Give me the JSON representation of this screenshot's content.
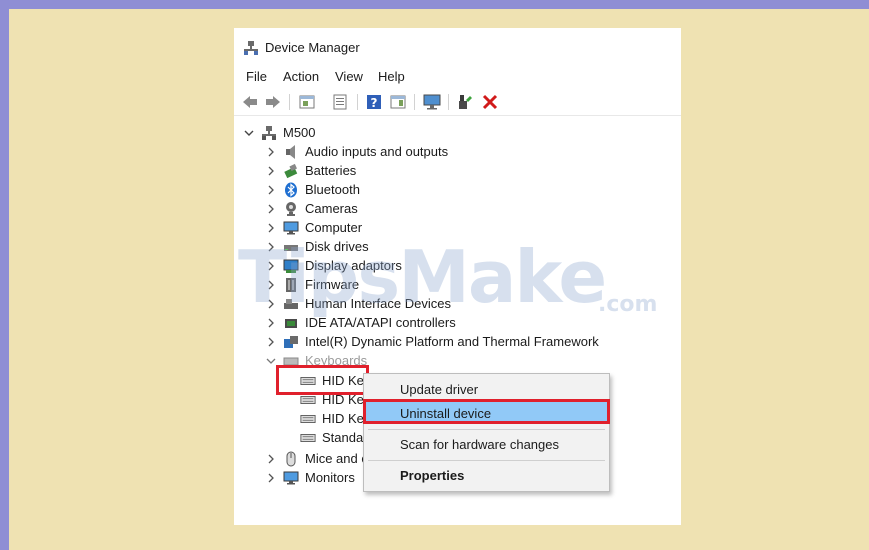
{
  "window": {
    "title": "Device Manager"
  },
  "menu": {
    "file": "File",
    "action": "Action",
    "view": "View",
    "help": "Help"
  },
  "tree": {
    "root": "M500",
    "categories": [
      {
        "label": "Audio inputs and outputs",
        "icon": "speaker-icon"
      },
      {
        "label": "Batteries",
        "icon": "battery-icon"
      },
      {
        "label": "Bluetooth",
        "icon": "bluetooth-icon"
      },
      {
        "label": "Cameras",
        "icon": "camera-icon"
      },
      {
        "label": "Computer",
        "icon": "computer-icon"
      },
      {
        "label": "Disk drives",
        "icon": "disk-icon"
      },
      {
        "label": "Display adaptors",
        "icon": "display-icon"
      },
      {
        "label": "Firmware",
        "icon": "firmware-icon"
      },
      {
        "label": "Human Interface Devices",
        "icon": "hid-icon"
      },
      {
        "label": "IDE ATA/ATAPI controllers",
        "icon": "ide-icon"
      },
      {
        "label": "Intel(R) Dynamic Platform and Thermal Framework",
        "icon": "intel-icon"
      },
      {
        "label": "Keyboards",
        "icon": "keyboard-icon"
      }
    ],
    "keyboards": [
      "HID Ke",
      "HID Ke",
      "HID Ke",
      "Standa"
    ],
    "after": [
      {
        "label": "Mice and c",
        "icon": "mouse-icon"
      },
      {
        "label": "Monitors",
        "icon": "monitor-icon"
      }
    ]
  },
  "context_menu": {
    "update_driver": "Update driver",
    "uninstall_device": "Uninstall device",
    "scan": "Scan for hardware changes",
    "properties": "Properties"
  },
  "watermark": {
    "main": "TipsMake",
    "suffix": ".com"
  },
  "colors": {
    "background": "#efe2b2",
    "frame": "#8f8ed4",
    "highlight": "#91c9f7",
    "annotation": "#e0202c"
  }
}
